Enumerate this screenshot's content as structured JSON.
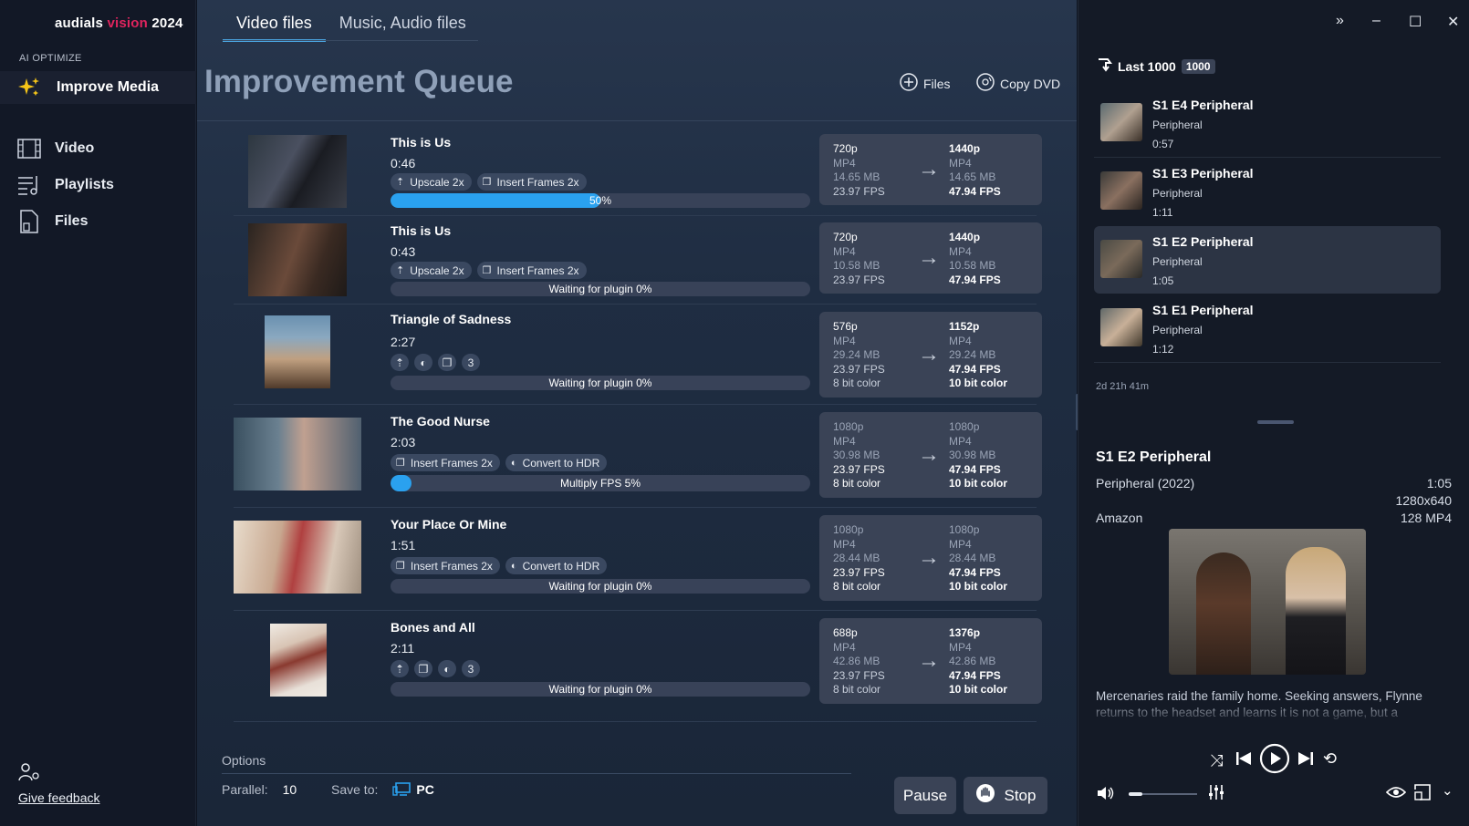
{
  "app": {
    "brand_prefix": "audials ",
    "brand_accent": "vision",
    "brand_suffix": " 2024"
  },
  "colors": {
    "accent": "#e0245e",
    "progress": "#2aa1ef",
    "panel": "#3a4356"
  },
  "sidebar": {
    "section_label": "AI OPTIMIZE",
    "active_item": {
      "label": "Improve Media",
      "icon": "sparkles-icon"
    },
    "items": [
      {
        "label": "Video",
        "icon": "film-icon"
      },
      {
        "label": "Playlists",
        "icon": "playlist-icon"
      },
      {
        "label": "Files",
        "icon": "file-icon"
      }
    ],
    "feedback": "Give feedback"
  },
  "main": {
    "tabs": [
      {
        "label": "Video files",
        "active": true
      },
      {
        "label": "Music, Audio files",
        "active": false
      }
    ],
    "title": "Improvement Queue",
    "add_files": "Files",
    "copy_dvd": "Copy DVD",
    "queue": [
      {
        "title": "This is Us",
        "duration": "0:46",
        "chips": [
          "Upscale 2x",
          "Insert Frames 2x"
        ],
        "progress_text": "50%",
        "progress": 0.5,
        "src": [
          "720p",
          "MP4",
          "14.65 MB",
          "23.97 FPS"
        ],
        "dst": [
          "1440p",
          "MP4",
          "14.65 MB",
          "47.94 FPS"
        ]
      },
      {
        "title": "This is Us",
        "duration": "0:43",
        "chips": [
          "Upscale 2x",
          "Insert Frames 2x"
        ],
        "progress_text": "Waiting for plugin 0%",
        "progress": 0,
        "src": [
          "720p",
          "MP4",
          "10.58 MB",
          "23.97 FPS"
        ],
        "dst": [
          "1440p",
          "MP4",
          "10.58 MB",
          "47.94 FPS"
        ]
      },
      {
        "title": "Triangle of Sadness",
        "duration": "2:27",
        "chips_count": "3",
        "progress_text": "Waiting for plugin 0%",
        "progress": 0,
        "src": [
          "576p",
          "MP4",
          "29.24 MB",
          "23.97 FPS",
          "8 bit color"
        ],
        "dst": [
          "1152p",
          "MP4",
          "29.24 MB",
          "47.94 FPS",
          "10 bit color"
        ]
      },
      {
        "title": "The Good Nurse",
        "duration": "2:03",
        "chips": [
          "Insert Frames 2x",
          "Convert to HDR"
        ],
        "progress_text": "Multiply FPS 5%",
        "progress": 0.05,
        "src": [
          "1080p",
          "MP4",
          "30.98 MB",
          "23.97 FPS",
          "8 bit color"
        ],
        "dst": [
          "1080p",
          "MP4",
          "30.98 MB",
          "47.94 FPS",
          "10 bit color"
        ]
      },
      {
        "title": "Your Place Or Mine",
        "duration": "1:51",
        "chips": [
          "Insert Frames 2x",
          "Convert to HDR"
        ],
        "progress_text": "Waiting for plugin 0%",
        "progress": 0,
        "src": [
          "1080p",
          "MP4",
          "28.44 MB",
          "23.97 FPS",
          "8 bit color"
        ],
        "dst": [
          "1080p",
          "MP4",
          "28.44 MB",
          "47.94 FPS",
          "10 bit color"
        ]
      },
      {
        "title": "Bones and All",
        "duration": "2:11",
        "chips_count": "3",
        "progress_text": "Waiting for plugin 0%",
        "progress": 0,
        "src": [
          "688p",
          "MP4",
          "42.86 MB",
          "23.97 FPS",
          "8 bit color"
        ],
        "dst": [
          "1376p",
          "MP4",
          "42.86 MB",
          "47.94 FPS",
          "10 bit color"
        ]
      }
    ],
    "options": {
      "label": "Options",
      "parallel_label": "Parallel:",
      "parallel_value": "10",
      "save_label": "Save to:",
      "save_value": "PC"
    },
    "pause": "Pause",
    "stop": "Stop"
  },
  "right": {
    "last_label": "Last 1000",
    "last_badge": "1000",
    "episodes": [
      {
        "title": "S1 E4 Peripheral",
        "sub": "Peripheral",
        "dur": "0:57"
      },
      {
        "title": "S1 E3 Peripheral",
        "sub": "Peripheral",
        "dur": "1:11"
      },
      {
        "title": "S1 E2 Peripheral",
        "sub": "Peripheral",
        "dur": "1:05"
      },
      {
        "title": "S1 E1 Peripheral",
        "sub": "Peripheral",
        "dur": "1:12"
      }
    ],
    "total": "2d 21h 41m",
    "detail": {
      "title": "S1 E2 Peripheral",
      "series": "Peripheral (2022)",
      "duration": "1:05",
      "resolution": "1280x640",
      "source": "Amazon",
      "size": "128 MP4",
      "description": "Mercenaries raid the family home. Seeking answers, Flynne returns to the headset and learns it is not a game, but a"
    },
    "volume": 0.2
  }
}
